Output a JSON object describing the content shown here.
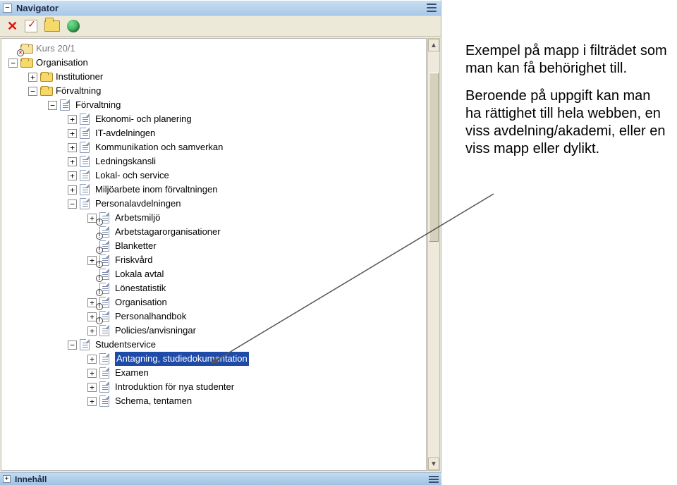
{
  "titlebar": {
    "toggle": "−",
    "title": "Navigator"
  },
  "bottombar": {
    "toggle": "+",
    "title": "Innehåll"
  },
  "toolbar": {
    "close": "✕",
    "check": "",
    "folder": "",
    "globe": ""
  },
  "tree": [
    {
      "depth": 0,
      "tg": "",
      "icon": "folder",
      "badge": "x",
      "dim": true,
      "label": "Kurs 20/1"
    },
    {
      "depth": 0,
      "tg": "−",
      "icon": "folder",
      "label": "Organisation"
    },
    {
      "depth": 1,
      "tg": "+",
      "icon": "folder",
      "label": "Institutioner"
    },
    {
      "depth": 1,
      "tg": "−",
      "icon": "folder",
      "label": "Förvaltning"
    },
    {
      "depth": 2,
      "tg": "−",
      "icon": "page",
      "label": "Förvaltning"
    },
    {
      "depth": 3,
      "tg": "+",
      "icon": "page",
      "label": "Ekonomi- och planering"
    },
    {
      "depth": 3,
      "tg": "+",
      "icon": "page",
      "label": "IT-avdelningen"
    },
    {
      "depth": 3,
      "tg": "+",
      "icon": "page",
      "label": "Kommunikation och samverkan"
    },
    {
      "depth": 3,
      "tg": "+",
      "icon": "page",
      "label": "Ledningskansli"
    },
    {
      "depth": 3,
      "tg": "+",
      "icon": "page",
      "label": "Lokal- och service"
    },
    {
      "depth": 3,
      "tg": "+",
      "icon": "page",
      "label": "Miljöarbete inom förvaltningen"
    },
    {
      "depth": 3,
      "tg": "−",
      "icon": "page",
      "label": "Personalavdelningen"
    },
    {
      "depth": 4,
      "tg": "+",
      "icon": "page",
      "badge": "i",
      "label": "Arbetsmiljö"
    },
    {
      "depth": 4,
      "tg": "",
      "icon": "page",
      "badge": "i",
      "label": "Arbetstagarorganisationer"
    },
    {
      "depth": 4,
      "tg": "",
      "icon": "page",
      "badge": "i",
      "label": "Blanketter"
    },
    {
      "depth": 4,
      "tg": "+",
      "icon": "page",
      "badge": "i",
      "label": "Friskvård"
    },
    {
      "depth": 4,
      "tg": "",
      "icon": "page",
      "badge": "i",
      "label": "Lokala avtal"
    },
    {
      "depth": 4,
      "tg": "",
      "icon": "page",
      "badge": "i",
      "label": "Lönestatistik"
    },
    {
      "depth": 4,
      "tg": "+",
      "icon": "page",
      "badge": "i",
      "label": "Organisation"
    },
    {
      "depth": 4,
      "tg": "+",
      "icon": "page",
      "badge": "i",
      "label": "Personalhandbok"
    },
    {
      "depth": 4,
      "tg": "+",
      "icon": "page",
      "label": "Policies/anvisningar"
    },
    {
      "depth": 3,
      "tg": "−",
      "icon": "page",
      "label": "Studentservice"
    },
    {
      "depth": 4,
      "tg": "+",
      "icon": "page",
      "selected": true,
      "label": "Antagning, studiedokumentation"
    },
    {
      "depth": 4,
      "tg": "+",
      "icon": "page",
      "label": "Examen"
    },
    {
      "depth": 4,
      "tg": "+",
      "icon": "page",
      "label": "Introduktion för nya studenter"
    },
    {
      "depth": 4,
      "tg": "+",
      "icon": "page",
      "label": "Schema, tentamen"
    }
  ],
  "annotation": {
    "p1": "Exempel på mapp i filträdet som man kan få behörighet till.",
    "p2": "Beroende på uppgift kan man ha rättighet till hela webben, en viss avdelning/akademi, eller en viss mapp eller dylikt."
  },
  "scroll": {
    "up": "▲",
    "down": "▼"
  }
}
